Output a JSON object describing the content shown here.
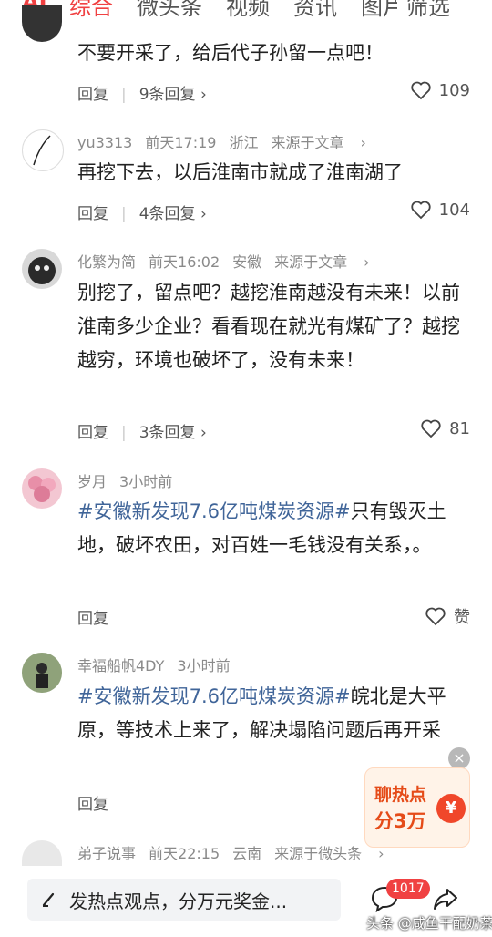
{
  "tabs": [
    "AI",
    "综合",
    "微头条",
    "视频",
    "资讯",
    "图片",
    "筛选"
  ],
  "comments": [
    {
      "user": "",
      "time": "",
      "location": "",
      "source": "",
      "body": "不要开采了，给后代子孙留一点吧！",
      "reply_label": "回复",
      "replies": "9条回复",
      "likes": "109"
    },
    {
      "user": "yu3313",
      "time": "前天17:19",
      "location": "浙江",
      "source": "来源于文章",
      "body": "再挖下去，以后淮南市就成了淮南湖了",
      "reply_label": "回复",
      "replies": "4条回复",
      "likes": "104"
    },
    {
      "user": "化繁为简",
      "time": "前天16:02",
      "location": "安徽",
      "source": "来源于文章",
      "body": "别挖了，留点吧？越挖淮南越没有未来！以前淮南多少企业？看看现在就光有煤矿了？越挖越穷，环境也破坏了，没有未来！",
      "reply_label": "回复",
      "replies": "3条回复",
      "likes": "81"
    },
    {
      "user": "岁月",
      "time": "3小时前",
      "hashtag": "#安徽新发现7.6亿吨煤炭资源#",
      "body": "只有毁灭土地，破坏农田，对百姓一毛钱没有关系，。",
      "reply_label": "回复",
      "likes": "赞"
    },
    {
      "user": "幸福船帆4DY",
      "time": "3小时前",
      "hashtag": "#安徽新发现7.6亿吨煤炭资源#",
      "body": "皖北是大平原，等技术上来了，解决塌陷问题后再开采",
      "reply_label": "回复"
    },
    {
      "user": "弟子说事",
      "time": "前天22:15",
      "location": "云南",
      "source": "来源于微头条"
    }
  ],
  "promo": {
    "line1": "聊热点",
    "line2": "分3万",
    "coin": "¥"
  },
  "bottom": {
    "input_placeholder": "发热点观点，分万元奖金...",
    "comment_count": "1017"
  },
  "watermark": "头条 @咸鱼干配奶茶",
  "colors": {
    "accent": "#f04142",
    "hashtag": "#406599",
    "meta": "#8a8a8a"
  }
}
